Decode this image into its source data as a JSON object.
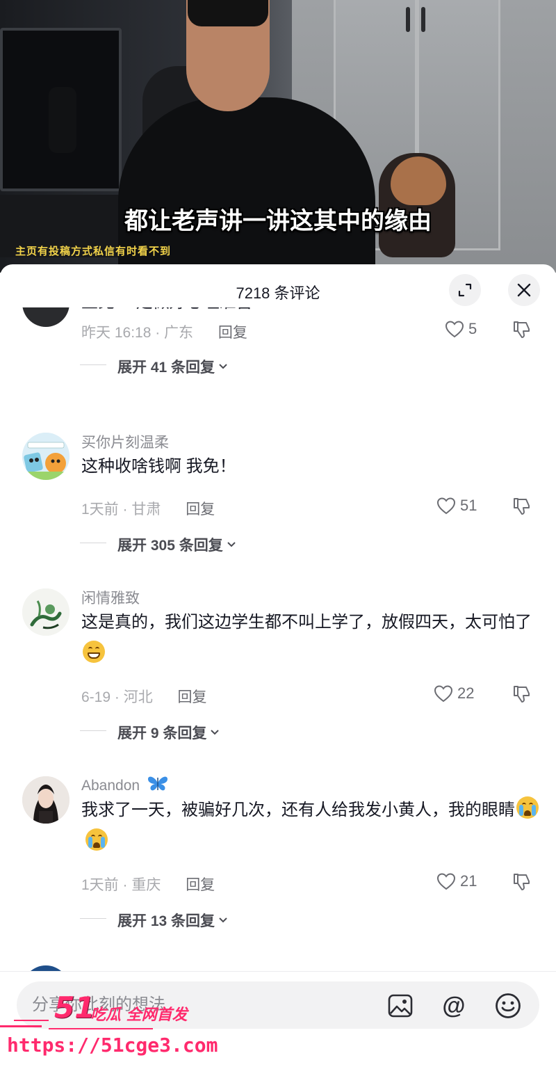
{
  "video": {
    "subtitle": "都让老声讲一讲这其中的缘由",
    "promo_text": "主页有投稿方式私信有时看不到"
  },
  "sheet": {
    "title": "7218 条评论",
    "expand_icon": "collapse-expand-icon",
    "close_icon": "close-icon"
  },
  "comments": [
    {
      "username": "",
      "text": "王免 一定做好心理准备",
      "time": "昨天 16:18 · 广东",
      "reply_label": "回复",
      "likes": "5",
      "expand_label": "展开 41 条回复"
    },
    {
      "username": "买你片刻温柔",
      "text": "这种收啥钱啊 我免！",
      "time": "1天前 · 甘肃",
      "reply_label": "回复",
      "likes": "51",
      "expand_label": "展开 305 条回复"
    },
    {
      "username": "闲情雅致",
      "text": "这是真的，我们这边学生都不叫上学了，放假四天，太可怕了",
      "time": "6-19 · 河北",
      "reply_label": "回复",
      "likes": "22",
      "expand_label": "展开 9 条回复"
    },
    {
      "username": "Abandon",
      "text": "我求了一天，被骗好几次，还有人给我发小黄人，我的眼睛",
      "time": "1天前 · 重庆",
      "reply_label": "回复",
      "likes": "21",
      "expand_label": "展开 13 条回复"
    }
  ],
  "input": {
    "placeholder": "分享你此刻的想法",
    "icons": [
      "image-icon",
      "at-icon",
      "emoji-icon"
    ]
  },
  "watermark": {
    "big": "51",
    "small": "吃瓜 全网首发",
    "url": "https://51cge3.com"
  },
  "colors": {
    "accent_pink": "#ff2a6d",
    "subtitle_yellow": "#f2d34a",
    "text_primary": "#161823",
    "text_secondary": "#8a8b91"
  }
}
